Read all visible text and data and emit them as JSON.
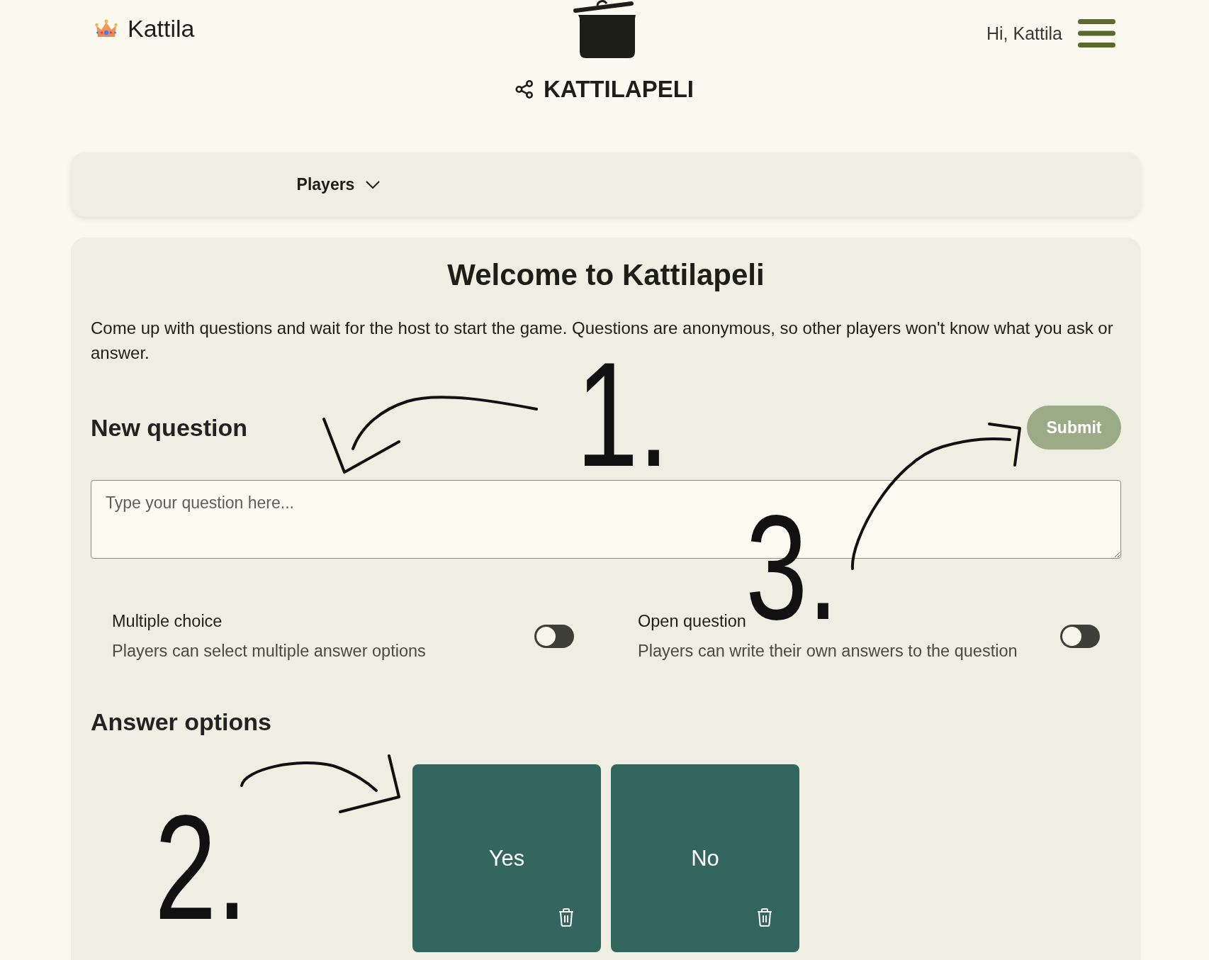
{
  "header": {
    "brand": "Kattila",
    "title": "KATTILAPELI",
    "greeting": "Hi, Kattila"
  },
  "players_panel": {
    "label": "Players",
    "expanded": false
  },
  "main": {
    "heading": "Welcome to Kattilapeli",
    "intro": "Come up with questions and wait for the host to start the game. Questions are anonymous, so other players won't know what you ask or answer.",
    "new_question": {
      "heading": "New question",
      "submit": "Submit",
      "placeholder": "Type your question here..."
    },
    "settings": [
      {
        "title": "Multiple choice",
        "description": "Players can select multiple answer options",
        "on": false
      },
      {
        "title": "Open question",
        "description": "Players can write their own answers to the question",
        "on": false
      }
    ],
    "answer_options": {
      "heading": "Answer options",
      "options": [
        {
          "label": "Yes"
        },
        {
          "label": "No"
        }
      ]
    }
  },
  "annotations": [
    {
      "label": "1."
    },
    {
      "label": "2."
    },
    {
      "label": "3."
    }
  ]
}
